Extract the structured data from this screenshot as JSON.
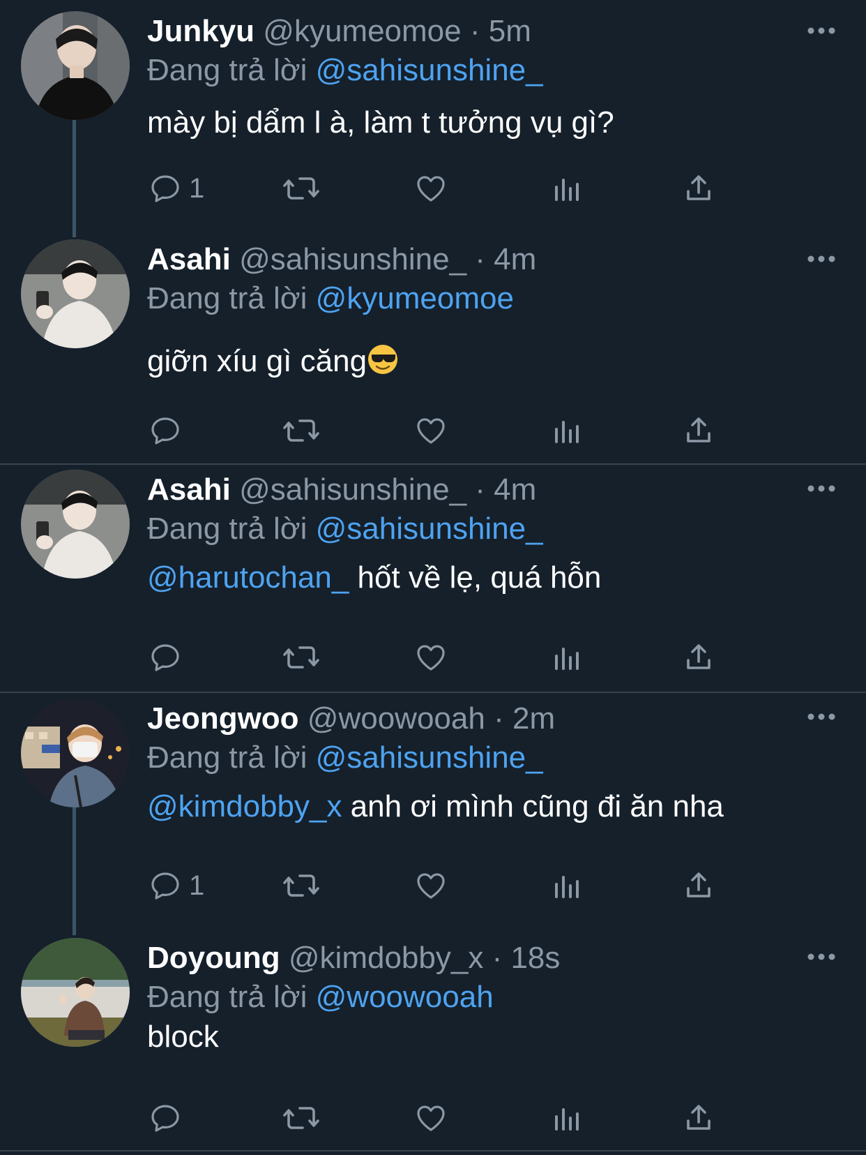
{
  "reply_prefix": "Đang trả lời",
  "tweets": [
    {
      "name": "Junkyu",
      "handle": "@kyumeomoe",
      "dot": "·",
      "time": "5m",
      "reply_to": "@sahisunshine_",
      "mention": "",
      "text": "mày bị dẩm l à, làm t tưởng vụ gì?",
      "reply_count": "1"
    },
    {
      "name": "Asahi",
      "handle": "@sahisunshine_",
      "dot": "·",
      "time": "4m",
      "reply_to": "@kyumeomoe",
      "mention": "",
      "text": "giỡn xíu gì căng",
      "emoji": "smiling-face-with-sunglasses",
      "reply_count": ""
    },
    {
      "name": "Asahi",
      "handle": "@sahisunshine_",
      "dot": "·",
      "time": "4m",
      "reply_to": "@sahisunshine_",
      "mention": "@harutochan_",
      "text": " hốt về lẹ, quá hỗn",
      "reply_count": ""
    },
    {
      "name": "Jeongwoo",
      "handle": "@woowooah",
      "dot": "·",
      "time": "2m",
      "reply_to": "@sahisunshine_",
      "mention": "@kimdobby_x",
      "text": " anh ơi mình cũng đi ăn nha",
      "reply_count": "1"
    },
    {
      "name": "Doyoung",
      "handle": "@kimdobby_x",
      "dot": "·",
      "time": "18s",
      "reply_to": "@woowooah",
      "mention": "",
      "text": "block",
      "reply_count": ""
    }
  ],
  "icons": {
    "reply": "reply-icon",
    "retweet": "retweet-icon",
    "like": "heart-icon",
    "analytics": "analytics-icon",
    "share": "share-icon",
    "more": "more-icon"
  },
  "colors": {
    "background": "#15202b",
    "text": "#ffffff",
    "secondary": "#8b98a5",
    "mention": "#4ea3f0",
    "divider": "#38444d",
    "thread": "#3d5466"
  }
}
